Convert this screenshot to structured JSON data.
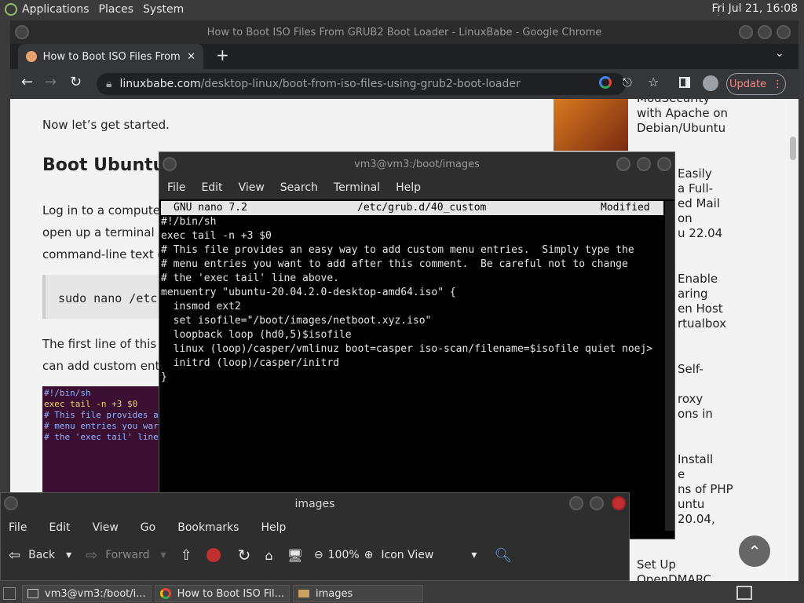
{
  "top_panel": {
    "menus": [
      "Applications",
      "Places",
      "System"
    ],
    "clock": "Fri Jul 21, 16:08"
  },
  "chrome": {
    "title": "How to Boot ISO Files From GRUB2 Boot Loader - LinuxBabe - Google Chrome",
    "tab_label": "How to Boot ISO Files From GR",
    "url_host": "linuxbabe.com",
    "url_path": "/desktop-linux/boot-from-iso-files-using-grub2-boot-loader",
    "update_label": "Update",
    "page": {
      "intro": "Now let’s get started.",
      "heading": "Boot Ubuntu I",
      "para_lines": [
        "Log in to a computer",
        "open up a terminal w",
        "command-line text e"
      ],
      "code": "sudo nano /etc",
      "para2_lines": [
        "The first line of this f",
        "can add custom entr"
      ],
      "code_img_lines": [
        "#!/bin/sh",
        "exec tail -n +3 $0",
        "# This file provides a",
        "# menu entries you war",
        "# the 'exec tail' line"
      ],
      "sidebar": [
        "ModSecurity",
        "with Apache on",
        "Debian/Ubuntu",
        "Easily",
        "a Full-",
        "ed Mail",
        "on",
        "u 22.04",
        "Enable",
        "aring",
        "en Host",
        "rtualbox",
        "Self-",
        "roxy",
        "ons in",
        "Install",
        "e",
        "ns of PHP",
        "untu",
        "20.04,",
        "Set Up",
        "OpenDMARC"
      ]
    }
  },
  "terminal": {
    "title": "vm3@vm3:/boot/images",
    "menu": [
      "File",
      "Edit",
      "View",
      "Search",
      "Terminal",
      "Help"
    ],
    "nano_version": "GNU nano 7.2",
    "nano_file": "/etc/grub.d/40_custom",
    "nano_status": "Modified",
    "lines": [
      "#!/bin/sh",
      "exec tail -n +3 $0",
      "# This file provides an easy way to add custom menu entries.  Simply type the",
      "# menu entries you want to add after this comment.  Be careful not to change",
      "# the 'exec tail' line above.",
      "",
      "menuentry \"ubuntu-20.04.2.0-desktop-amd64.iso\" {",
      "  insmod ext2",
      "  set isofile=\"/boot/images/netboot.xyz.iso\"",
      "  loopback loop (hd0,5)$isofile",
      "  linux (loop)/casper/vmlinuz boot=casper iso-scan/filename=$isofile quiet noej>",
      "  initrd (loop)/casper/initrd",
      "}"
    ]
  },
  "filemanager": {
    "title": "images",
    "menu": [
      "File",
      "Edit",
      "View",
      "Go",
      "Bookmarks",
      "Help"
    ],
    "back": "Back",
    "forward": "Forward",
    "zoom": "100%",
    "view_mode": "Icon View"
  },
  "taskbar": {
    "tasks": [
      "vm3@vm3:/boot/i...",
      "How to Boot ISO Fil...",
      "images"
    ]
  }
}
